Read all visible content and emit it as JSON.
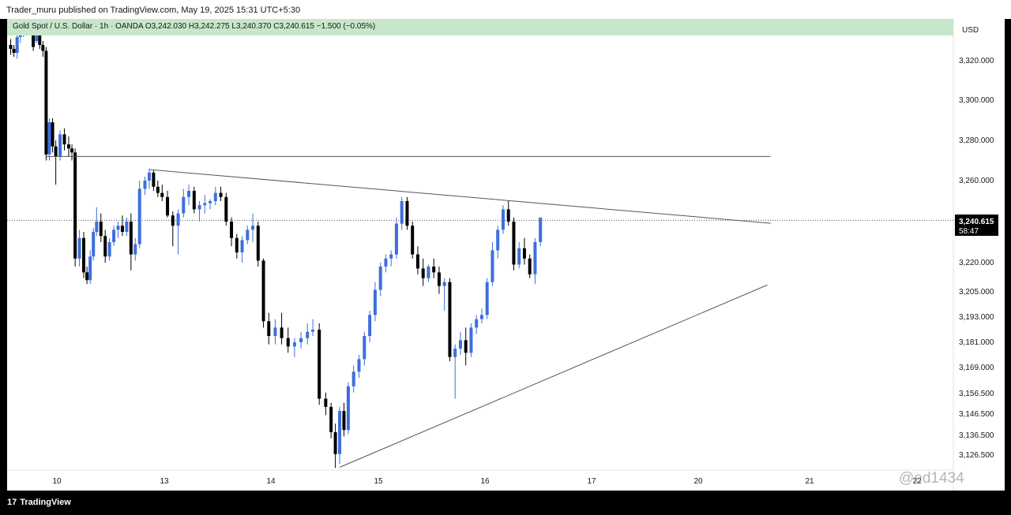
{
  "header": {
    "publish_line": "Trader_muru published on TradingView.com, May 19, 2025 15:31 UTC+5:30"
  },
  "legend": {
    "symbol": "Gold Spot / U.S. Dollar · 1h · OANDA",
    "open": "O3,242.030",
    "high": "H3,242.275",
    "low": "L3,240.370",
    "close": "C3,240.615",
    "change": "−1.500 (−0.05%)"
  },
  "price_scale": {
    "currency": "USD",
    "last_price": "3,240.615",
    "countdown": "58:47"
  },
  "footer": {
    "brand": "TradingView",
    "logo_glyph": "17",
    "watermark": "@ed1434"
  },
  "colors": {
    "up": "#3d6fdc",
    "down": "#000000",
    "legend_bg": "#c8e6c9",
    "trendline": "#555555"
  },
  "chart_data": {
    "type": "candlestick",
    "timeframe": "1h",
    "symbol": "XAUUSD",
    "y_ticks": [
      {
        "label": "3,320.000",
        "value": 3320
      },
      {
        "label": "3,300.000",
        "value": 3300
      },
      {
        "label": "3,280.000",
        "value": 3280
      },
      {
        "label": "3,260.000",
        "value": 3260
      },
      {
        "label": "3,220.000",
        "value": 3220
      },
      {
        "label": "3,205.000",
        "value": 3205
      },
      {
        "label": "3,193.000",
        "value": 3193
      },
      {
        "label": "3,181.000",
        "value": 3181
      },
      {
        "label": "3,169.000",
        "value": 3169
      },
      {
        "label": "3,156.500",
        "value": 3156.5
      },
      {
        "label": "3,146.500",
        "value": 3146.5
      },
      {
        "label": "3,136.500",
        "value": 3136.5
      },
      {
        "label": "3,126.500",
        "value": 3126.5
      }
    ],
    "x_ticks": [
      {
        "label": "10",
        "x": 0
      },
      {
        "label": "13",
        "x": 1
      },
      {
        "label": "14",
        "x": 2
      },
      {
        "label": "15",
        "x": 3
      },
      {
        "label": "16",
        "x": 4
      },
      {
        "label": "17",
        "x": 5
      },
      {
        "label": "20",
        "x": 6
      },
      {
        "label": "21",
        "x": 7
      },
      {
        "label": "22",
        "x": 8
      }
    ],
    "candles": [
      {
        "x": -0.43,
        "o": 3328,
        "h": 3331,
        "l": 3323,
        "c": 3326
      },
      {
        "x": -0.4,
        "o": 3326,
        "h": 3328,
        "l": 3322,
        "c": 3324
      },
      {
        "x": -0.37,
        "o": 3324,
        "h": 3334,
        "l": 3321,
        "c": 3332
      },
      {
        "x": -0.34,
        "o": 3332,
        "h": 3337,
        "l": 3329,
        "c": 3335
      },
      {
        "x": -0.31,
        "o": 3335,
        "h": 3340,
        "l": 3332,
        "c": 3338
      },
      {
        "x": -0.28,
        "o": 3338,
        "h": 3342,
        "l": 3334,
        "c": 3340
      },
      {
        "x": -0.25,
        "o": 3340,
        "h": 3342,
        "l": 3334,
        "c": 3336
      },
      {
        "x": -0.22,
        "o": 3336,
        "h": 3340,
        "l": 3325,
        "c": 3327
      },
      {
        "x": -0.19,
        "o": 3330,
        "h": 3340,
        "l": 3329,
        "c": 3337
      },
      {
        "x": -0.16,
        "o": 3337,
        "h": 3338,
        "l": 3326,
        "c": 3328
      },
      {
        "x": -0.13,
        "o": 3328,
        "h": 3330,
        "l": 3322,
        "c": 3325
      },
      {
        "x": -0.1,
        "o": 3325,
        "h": 3327,
        "l": 3270,
        "c": 3273
      },
      {
        "x": -0.07,
        "o": 3273,
        "h": 3291,
        "l": 3270,
        "c": 3289
      },
      {
        "x": -0.04,
        "o": 3289,
        "h": 3291,
        "l": 3274,
        "c": 3277
      },
      {
        "x": -0.01,
        "o": 3277,
        "h": 3280,
        "l": 3258,
        "c": 3272
      },
      {
        "x": 0.03,
        "o": 3272,
        "h": 3285,
        "l": 3270,
        "c": 3283
      },
      {
        "x": 0.07,
        "o": 3283,
        "h": 3286,
        "l": 3275,
        "c": 3278
      },
      {
        "x": 0.11,
        "o": 3278,
        "h": 3282,
        "l": 3272,
        "c": 3276
      },
      {
        "x": 0.14,
        "o": 3276,
        "h": 3278,
        "l": 3270,
        "c": 3274
      },
      {
        "x": 0.17,
        "o": 3274,
        "h": 3276,
        "l": 3218,
        "c": 3222
      },
      {
        "x": 0.21,
        "o": 3222,
        "h": 3236,
        "l": 3218,
        "c": 3232
      },
      {
        "x": 0.25,
        "o": 3232,
        "h": 3235,
        "l": 3212,
        "c": 3215
      },
      {
        "x": 0.28,
        "o": 3215,
        "h": 3218,
        "l": 3209,
        "c": 3211
      },
      {
        "x": 0.31,
        "o": 3211,
        "h": 3226,
        "l": 3209,
        "c": 3223
      },
      {
        "x": 0.34,
        "o": 3223,
        "h": 3237,
        "l": 3221,
        "c": 3235
      },
      {
        "x": 0.37,
        "o": 3235,
        "h": 3247,
        "l": 3233,
        "c": 3240
      },
      {
        "x": 0.41,
        "o": 3240,
        "h": 3244,
        "l": 3230,
        "c": 3233
      },
      {
        "x": 0.45,
        "o": 3233,
        "h": 3236,
        "l": 3220,
        "c": 3223
      },
      {
        "x": 0.49,
        "o": 3223,
        "h": 3232,
        "l": 3221,
        "c": 3230
      },
      {
        "x": 0.53,
        "o": 3230,
        "h": 3238,
        "l": 3228,
        "c": 3236
      },
      {
        "x": 0.57,
        "o": 3236,
        "h": 3240,
        "l": 3232,
        "c": 3238
      },
      {
        "x": 0.61,
        "o": 3238,
        "h": 3243,
        "l": 3233,
        "c": 3235
      },
      {
        "x": 0.65,
        "o": 3235,
        "h": 3242,
        "l": 3233,
        "c": 3240
      },
      {
        "x": 0.69,
        "o": 3240,
        "h": 3244,
        "l": 3216,
        "c": 3224
      },
      {
        "x": 0.73,
        "o": 3224,
        "h": 3232,
        "l": 3221,
        "c": 3229
      },
      {
        "x": 0.77,
        "o": 3229,
        "h": 3260,
        "l": 3227,
        "c": 3256
      },
      {
        "x": 0.82,
        "o": 3256,
        "h": 3262,
        "l": 3253,
        "c": 3260
      },
      {
        "x": 0.86,
        "o": 3260,
        "h": 3266,
        "l": 3256,
        "c": 3264
      },
      {
        "x": 0.9,
        "o": 3264,
        "h": 3265,
        "l": 3255,
        "c": 3257
      },
      {
        "x": 0.94,
        "o": 3257,
        "h": 3260,
        "l": 3252,
        "c": 3254
      },
      {
        "x": 0.98,
        "o": 3254,
        "h": 3258,
        "l": 3250,
        "c": 3252
      },
      {
        "x": 1.03,
        "o": 3252,
        "h": 3255,
        "l": 3242,
        "c": 3243
      },
      {
        "x": 1.08,
        "o": 3243,
        "h": 3245,
        "l": 3228,
        "c": 3238
      },
      {
        "x": 1.13,
        "o": 3238,
        "h": 3246,
        "l": 3224,
        "c": 3244
      },
      {
        "x": 1.18,
        "o": 3244,
        "h": 3256,
        "l": 3242,
        "c": 3252
      },
      {
        "x": 1.23,
        "o": 3252,
        "h": 3258,
        "l": 3248,
        "c": 3255
      },
      {
        "x": 1.28,
        "o": 3255,
        "h": 3257,
        "l": 3244,
        "c": 3246
      },
      {
        "x": 1.33,
        "o": 3246,
        "h": 3250,
        "l": 3240,
        "c": 3248
      },
      {
        "x": 1.38,
        "o": 3248,
        "h": 3253,
        "l": 3244,
        "c": 3249
      },
      {
        "x": 1.43,
        "o": 3249,
        "h": 3251,
        "l": 3246,
        "c": 3250
      },
      {
        "x": 1.48,
        "o": 3250,
        "h": 3257,
        "l": 3248,
        "c": 3254
      },
      {
        "x": 1.53,
        "o": 3254,
        "h": 3257,
        "l": 3250,
        "c": 3252
      },
      {
        "x": 1.58,
        "o": 3252,
        "h": 3254,
        "l": 3238,
        "c": 3240
      },
      {
        "x": 1.63,
        "o": 3240,
        "h": 3242,
        "l": 3228,
        "c": 3232
      },
      {
        "x": 1.68,
        "o": 3232,
        "h": 3234,
        "l": 3222,
        "c": 3225
      },
      {
        "x": 1.73,
        "o": 3225,
        "h": 3233,
        "l": 3220,
        "c": 3231
      },
      {
        "x": 1.78,
        "o": 3231,
        "h": 3238,
        "l": 3229,
        "c": 3236
      },
      {
        "x": 1.83,
        "o": 3236,
        "h": 3244,
        "l": 3230,
        "c": 3238
      },
      {
        "x": 1.88,
        "o": 3238,
        "h": 3240,
        "l": 3218,
        "c": 3221
      },
      {
        "x": 1.93,
        "o": 3221,
        "h": 3222,
        "l": 3188,
        "c": 3191
      },
      {
        "x": 1.98,
        "o": 3191,
        "h": 3195,
        "l": 3180,
        "c": 3184
      },
      {
        "x": 2.04,
        "o": 3184,
        "h": 3192,
        "l": 3180,
        "c": 3188
      },
      {
        "x": 2.1,
        "o": 3188,
        "h": 3195,
        "l": 3180,
        "c": 3183
      },
      {
        "x": 2.16,
        "o": 3183,
        "h": 3188,
        "l": 3176,
        "c": 3179
      },
      {
        "x": 2.22,
        "o": 3179,
        "h": 3183,
        "l": 3174,
        "c": 3181
      },
      {
        "x": 2.28,
        "o": 3181,
        "h": 3186,
        "l": 3178,
        "c": 3183
      },
      {
        "x": 2.34,
        "o": 3183,
        "h": 3190,
        "l": 3180,
        "c": 3186
      },
      {
        "x": 2.39,
        "o": 3186,
        "h": 3192,
        "l": 3184,
        "c": 3187
      },
      {
        "x": 2.45,
        "o": 3187,
        "h": 3190,
        "l": 3151,
        "c": 3154
      },
      {
        "x": 2.51,
        "o": 3154,
        "h": 3157,
        "l": 3146,
        "c": 3150
      },
      {
        "x": 2.56,
        "o": 3150,
        "h": 3152,
        "l": 3135,
        "c": 3138
      },
      {
        "x": 2.6,
        "o": 3138,
        "h": 3142,
        "l": 3120,
        "c": 3127
      },
      {
        "x": 2.64,
        "o": 3127,
        "h": 3150,
        "l": 3122,
        "c": 3148
      },
      {
        "x": 2.68,
        "o": 3148,
        "h": 3152,
        "l": 3136,
        "c": 3139
      },
      {
        "x": 2.72,
        "o": 3139,
        "h": 3162,
        "l": 3137,
        "c": 3160
      },
      {
        "x": 2.77,
        "o": 3160,
        "h": 3170,
        "l": 3157,
        "c": 3167
      },
      {
        "x": 2.82,
        "o": 3167,
        "h": 3175,
        "l": 3164,
        "c": 3173
      },
      {
        "x": 2.87,
        "o": 3173,
        "h": 3186,
        "l": 3170,
        "c": 3184
      },
      {
        "x": 2.92,
        "o": 3184,
        "h": 3196,
        "l": 3181,
        "c": 3194
      },
      {
        "x": 2.97,
        "o": 3194,
        "h": 3210,
        "l": 3191,
        "c": 3206
      },
      {
        "x": 3.02,
        "o": 3206,
        "h": 3220,
        "l": 3203,
        "c": 3218
      },
      {
        "x": 3.07,
        "o": 3218,
        "h": 3224,
        "l": 3215,
        "c": 3222
      },
      {
        "x": 3.12,
        "o": 3222,
        "h": 3226,
        "l": 3218,
        "c": 3224
      },
      {
        "x": 3.17,
        "o": 3224,
        "h": 3242,
        "l": 3222,
        "c": 3239
      },
      {
        "x": 3.22,
        "o": 3239,
        "h": 3252,
        "l": 3236,
        "c": 3250
      },
      {
        "x": 3.27,
        "o": 3250,
        "h": 3252,
        "l": 3236,
        "c": 3238
      },
      {
        "x": 3.32,
        "o": 3238,
        "h": 3240,
        "l": 3222,
        "c": 3224
      },
      {
        "x": 3.37,
        "o": 3224,
        "h": 3228,
        "l": 3214,
        "c": 3217
      },
      {
        "x": 3.42,
        "o": 3217,
        "h": 3222,
        "l": 3208,
        "c": 3212
      },
      {
        "x": 3.47,
        "o": 3212,
        "h": 3219,
        "l": 3210,
        "c": 3218
      },
      {
        "x": 3.52,
        "o": 3218,
        "h": 3222,
        "l": 3212,
        "c": 3215
      },
      {
        "x": 3.57,
        "o": 3215,
        "h": 3218,
        "l": 3204,
        "c": 3208
      },
      {
        "x": 3.62,
        "o": 3208,
        "h": 3212,
        "l": 3196,
        "c": 3210
      },
      {
        "x": 3.67,
        "o": 3210,
        "h": 3212,
        "l": 3172,
        "c": 3174
      },
      {
        "x": 3.72,
        "o": 3174,
        "h": 3180,
        "l": 3154,
        "c": 3178
      },
      {
        "x": 3.77,
        "o": 3178,
        "h": 3186,
        "l": 3175,
        "c": 3182
      },
      {
        "x": 3.82,
        "o": 3182,
        "h": 3188,
        "l": 3170,
        "c": 3176
      },
      {
        "x": 3.87,
        "o": 3176,
        "h": 3190,
        "l": 3174,
        "c": 3188
      },
      {
        "x": 3.92,
        "o": 3188,
        "h": 3194,
        "l": 3185,
        "c": 3192
      },
      {
        "x": 3.97,
        "o": 3192,
        "h": 3197,
        "l": 3190,
        "c": 3194
      },
      {
        "x": 4.02,
        "o": 3194,
        "h": 3212,
        "l": 3192,
        "c": 3210
      },
      {
        "x": 4.07,
        "o": 3210,
        "h": 3230,
        "l": 3208,
        "c": 3226
      },
      {
        "x": 4.12,
        "o": 3226,
        "h": 3238,
        "l": 3222,
        "c": 3236
      },
      {
        "x": 4.17,
        "o": 3236,
        "h": 3248,
        "l": 3234,
        "c": 3246
      },
      {
        "x": 4.22,
        "o": 3246,
        "h": 3250,
        "l": 3238,
        "c": 3240
      },
      {
        "x": 4.27,
        "o": 3240,
        "h": 3242,
        "l": 3216,
        "c": 3219
      },
      {
        "x": 4.32,
        "o": 3219,
        "h": 3230,
        "l": 3217,
        "c": 3227
      },
      {
        "x": 4.37,
        "o": 3227,
        "h": 3232,
        "l": 3219,
        "c": 3222
      },
      {
        "x": 4.42,
        "o": 3222,
        "h": 3224,
        "l": 3212,
        "c": 3214
      },
      {
        "x": 4.47,
        "o": 3214,
        "h": 3232,
        "l": 3209,
        "c": 3230
      },
      {
        "x": 4.52,
        "o": 3230,
        "h": 3242,
        "l": 3228,
        "c": 3242
      }
    ],
    "horizontal_line": {
      "y": 3272,
      "x_start": -0.1,
      "x_end": 6.65
    },
    "trendlines": [
      {
        "x1": 0.86,
        "y1": 3265.5,
        "x2": 6.65,
        "y2": 3239.2
      },
      {
        "x1": 2.64,
        "y1": 3120.3,
        "x2": 6.62,
        "y2": 3208.5
      }
    ],
    "last_price_line": 3240.615
  }
}
